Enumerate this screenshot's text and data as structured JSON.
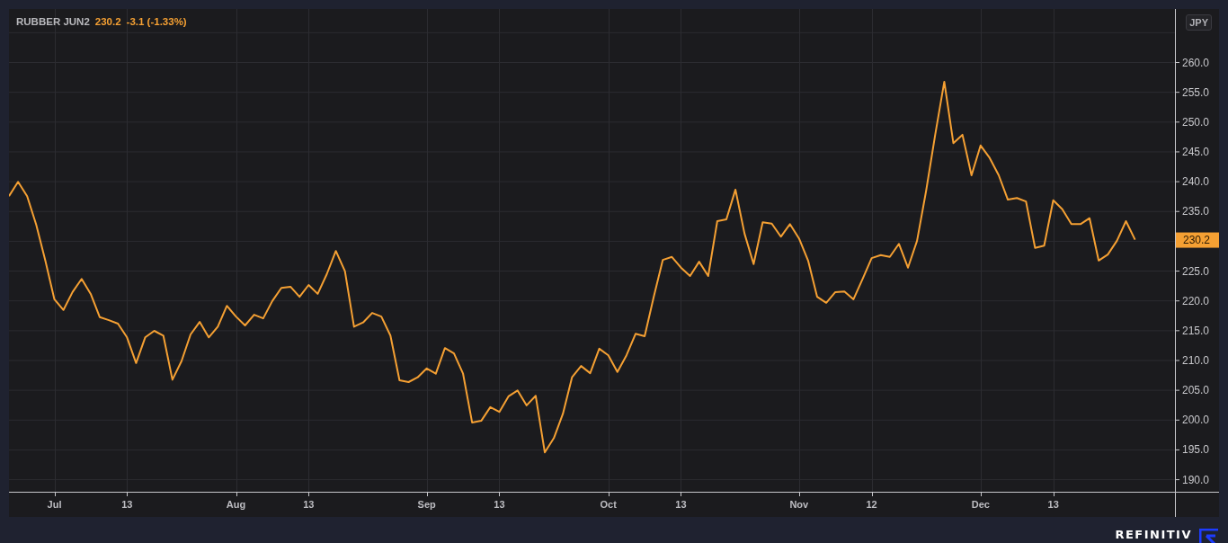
{
  "legend": {
    "symbol": "RUBBER JUN2",
    "last": "230.2",
    "change": "-3.1 (-1.33%)"
  },
  "currency_badge": "JPY",
  "price_tag": "230.2",
  "chart_data": {
    "type": "line",
    "grid": true,
    "ylim": [
      187.9,
      268.9
    ],
    "yticks": [
      {
        "value": 190,
        "label": "190.0"
      },
      {
        "value": 195,
        "label": "195.0"
      },
      {
        "value": 200,
        "label": "200.0"
      },
      {
        "value": 205,
        "label": "205.0"
      },
      {
        "value": 210,
        "label": "210.0"
      },
      {
        "value": 215,
        "label": "215.0"
      },
      {
        "value": 220,
        "label": "220.0"
      },
      {
        "value": 225,
        "label": "225.0"
      },
      {
        "value": 235,
        "label": "235.0"
      },
      {
        "value": 240,
        "label": "240.0"
      },
      {
        "value": 245,
        "label": "245.0"
      },
      {
        "value": 250,
        "label": "250.0"
      },
      {
        "value": 255,
        "label": "255.0"
      },
      {
        "value": 260,
        "label": "260.0"
      }
    ],
    "categories": [
      null,
      null,
      null,
      null,
      null,
      "Jul",
      null,
      null,
      null,
      null,
      null,
      null,
      null,
      "13",
      null,
      null,
      null,
      null,
      null,
      null,
      null,
      null,
      null,
      null,
      null,
      "Aug",
      null,
      null,
      null,
      null,
      null,
      null,
      null,
      "13",
      null,
      null,
      null,
      null,
      null,
      null,
      null,
      null,
      null,
      null,
      null,
      null,
      "Sep",
      null,
      null,
      null,
      null,
      null,
      null,
      null,
      "13",
      null,
      null,
      null,
      null,
      null,
      null,
      null,
      null,
      null,
      null,
      null,
      "Oct",
      null,
      null,
      null,
      null,
      null,
      null,
      null,
      "13",
      null,
      null,
      null,
      null,
      null,
      null,
      null,
      null,
      null,
      null,
      null,
      null,
      "Nov",
      null,
      null,
      null,
      null,
      null,
      null,
      null,
      "12",
      null,
      null,
      null,
      null,
      null,
      null,
      null,
      null,
      null,
      null,
      null,
      "Dec",
      null,
      null,
      null,
      null,
      null,
      null,
      null,
      "13",
      null,
      null,
      null,
      null,
      null,
      null,
      null,
      null,
      null
    ],
    "series": [
      {
        "color": "#f5a033",
        "values": [
          237.5,
          239.9,
          237.5,
          232.7,
          226.7,
          220.2,
          218.4,
          221.4,
          223.6,
          221.1,
          217.2,
          216.7,
          216.1,
          213.8,
          209.5,
          213.8,
          214.9,
          214.1,
          206.7,
          209.8,
          214.3,
          216.4,
          213.8,
          215.6,
          219.1,
          217.3,
          215.8,
          217.6,
          217,
          219.9,
          222.1,
          222.3,
          220.6,
          222.6,
          221.1,
          224.4,
          228.3,
          224.9,
          215.6,
          216.3,
          217.9,
          217.3,
          214.1,
          206.6,
          206.3,
          207.1,
          208.6,
          207.7,
          212,
          211.1,
          207.7,
          199.5,
          199.8,
          202.1,
          201.3,
          203.9,
          204.9,
          202.4,
          204,
          194.5,
          196.9,
          201,
          207.1,
          209,
          207.8,
          211.9,
          210.8,
          208,
          210.8,
          214.4,
          214,
          220.6,
          226.8,
          227.3,
          225.5,
          224.1,
          226.5,
          224.1,
          233.3,
          233.6,
          238.6,
          231.2,
          226.1,
          233.1,
          232.9,
          230.7,
          232.8,
          230.4,
          226.7,
          220.6,
          219.6,
          221.4,
          221.5,
          220.2,
          223.6,
          227.1,
          227.6,
          227.3,
          229.5,
          225.5,
          230,
          238.4,
          247.8,
          256.7,
          246.4,
          247.8,
          241,
          246,
          243.9,
          241,
          236.9,
          237.2,
          236.6,
          228.8,
          229.2,
          236.8,
          235.3,
          232.8,
          232.8,
          233.8,
          226.7,
          227.7,
          230,
          233.3,
          230.2
        ]
      }
    ]
  },
  "footer": {
    "brand": "REFINITIV"
  }
}
